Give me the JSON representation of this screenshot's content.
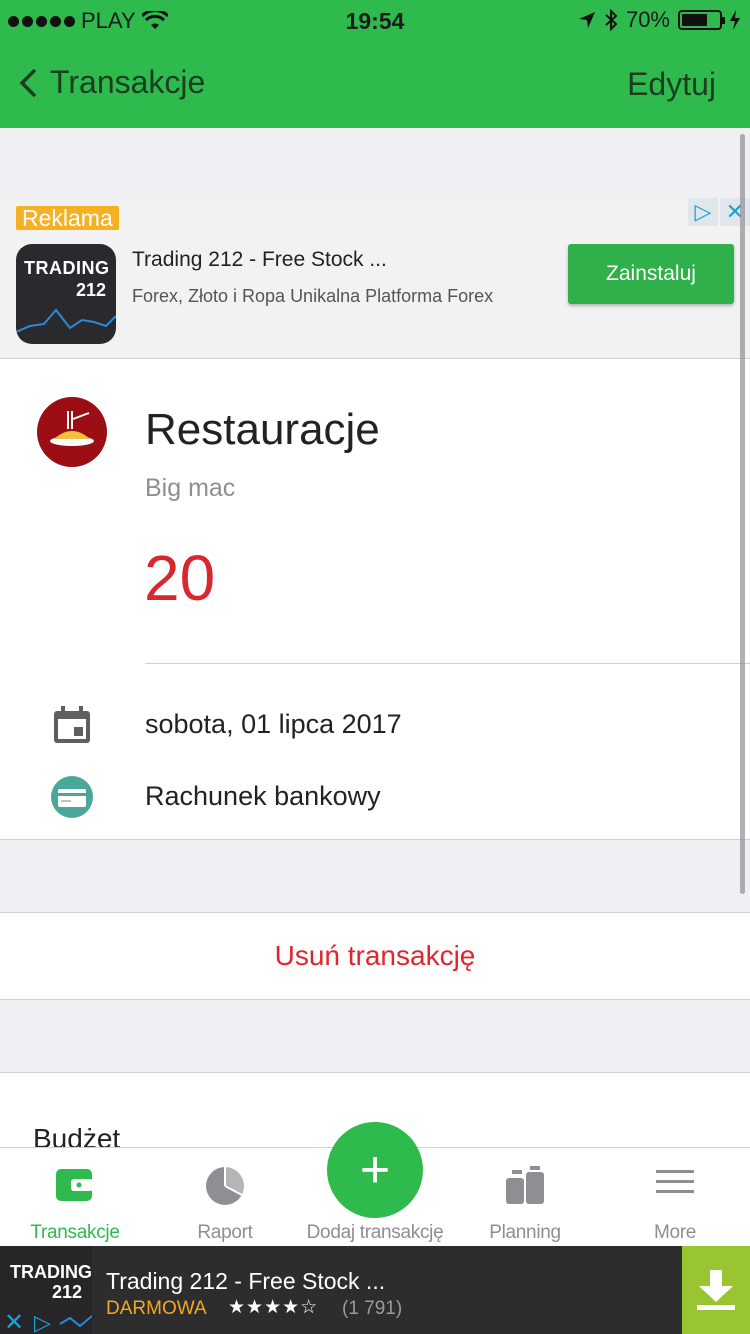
{
  "status_bar": {
    "carrier": "PLAY",
    "time": "19:54",
    "battery": "70%"
  },
  "nav": {
    "back_label": "Transakcje",
    "edit_label": "Edytuj"
  },
  "ad_top": {
    "badge": "Reklama",
    "logo_top": "TRADING",
    "logo_bottom": "212",
    "title": "Trading 212 - Free Stock ...",
    "subtitle": "Forex, Złoto i Ropa Unikalna Platforma Forex",
    "install_label": "Zainstaluj"
  },
  "transaction": {
    "category": "Restauracje",
    "note": "Big mac",
    "amount": "20",
    "date": "sobota, 01 lipca 2017",
    "account": "Rachunek bankowy"
  },
  "delete_label": "Usuń transakcję",
  "budget_label": "Budżet",
  "tabs": [
    {
      "label": "Transakcje",
      "icon": "wallet-icon",
      "active": true
    },
    {
      "label": "Raport",
      "icon": "pie-chart-icon",
      "active": false
    },
    {
      "label": "Dodaj transakcję",
      "icon": "plus-icon",
      "active": false
    },
    {
      "label": "Planning",
      "icon": "planning-icon",
      "active": false
    },
    {
      "label": "More",
      "icon": "menu-icon",
      "active": false
    }
  ],
  "ad_bottom": {
    "logo_top": "TRADING",
    "logo_bottom": "212",
    "title": "Trading 212 - Free Stock ...",
    "price": "DARMOWA",
    "stars": "★★★★☆",
    "rating_count": "(1 791)"
  },
  "colors": {
    "primary": "#2fba4d",
    "amount": "#d8282f",
    "delete": "#e0262d",
    "category_icon_bg": "#9b0f14",
    "ad_badge": "#f5b024"
  }
}
